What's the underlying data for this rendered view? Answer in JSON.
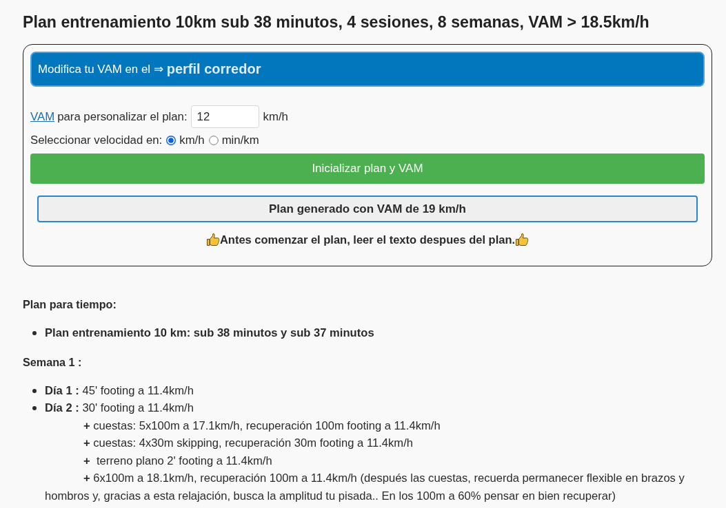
{
  "page_title": "Plan entrenamiento 10km sub 38 minutos, 4 sesiones, 8 semanas, VAM > 18.5km/h",
  "profile_banner": {
    "text": "Modifica tu VAM en el ⇒",
    "link": "perfil corredor"
  },
  "vam_field": {
    "link": "VAM",
    "label": "para personalizar el plan:",
    "value": "12",
    "unit": "km/h"
  },
  "speed_unit": {
    "label": "Seleccionar velocidad en:",
    "options": [
      {
        "label": "km/h",
        "selected": true
      },
      {
        "label": "min/km",
        "selected": false
      }
    ]
  },
  "init_button": "Inicializar plan y VAM",
  "plan_status_button": "Plan generado con VAM de 19 km/h",
  "notice": "Antes comenzar el plan, leer el texto despues del plan.",
  "plan_heading": "Plan para tiempo:",
  "plan_goals": [
    "Plan entrenamiento 10 km: sub 38 minutos y sub 37 minutos"
  ],
  "weeks": [
    {
      "title": "Semana 1 :",
      "days": [
        {
          "text": "**Día 1 :** 45' footing a 11.4km/h"
        },
        {
          "text": "**Día 2 :** 30' footing a 11.4km/h",
          "steps": [
            "**+** cuestas: 5x100m a 17.1km/h, recuperación 100m footing a 11.4km/h",
            "**+** cuestas: 4x30m skipping, recuperación 30m footing a 11.4km/h",
            "**+**  terreno plano 2' footing a 11.4km/h",
            "**+** 6x100m a 18.1km/h, recuperación 100m a 11.4km/h (después las cuestas, recuerda permanecer flexible en brazos y hombros y, gracias a esta relajación, busca la amplitud tu pisada.. En los 100m a 60% pensar en bien recuperar)"
          ]
        }
      ]
    }
  ]
}
